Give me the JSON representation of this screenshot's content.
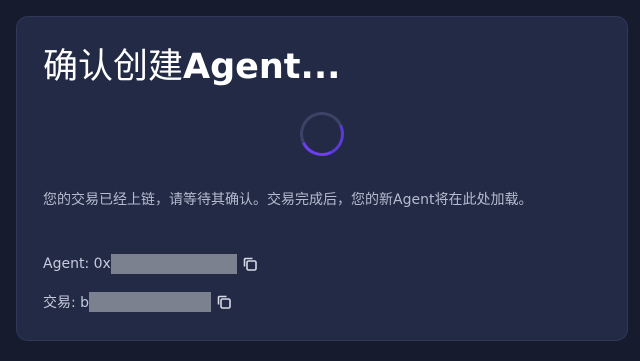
{
  "dialog": {
    "title_cn": "确认创建",
    "title_en": "Agent...",
    "description": "您的交易已经上链，请等待其确认。交易完成后，您的新Agent将在此处加载。",
    "agent": {
      "label": "Agent: 0x"
    },
    "transaction": {
      "label": "交易: b"
    },
    "icons": {
      "spinner": "loading-spinner",
      "copy": "copy-icon"
    },
    "colors": {
      "background": "#161b2e",
      "card": "#222a45",
      "accent": "#6d3ff0",
      "redaction": "#7c8190"
    }
  }
}
